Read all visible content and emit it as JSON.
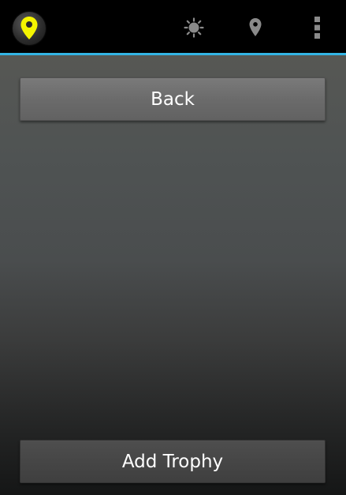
{
  "action_bar": {
    "app_icon": "yellow-map-pin-icon",
    "actions": [
      {
        "name": "sun-icon"
      },
      {
        "name": "location-pin-icon"
      },
      {
        "name": "overflow-menu-icon"
      }
    ],
    "accent_color": "#33b5e5",
    "pin_color": "#f5f500"
  },
  "main": {
    "back_label": "Back",
    "add_trophy_label": "Add Trophy"
  }
}
